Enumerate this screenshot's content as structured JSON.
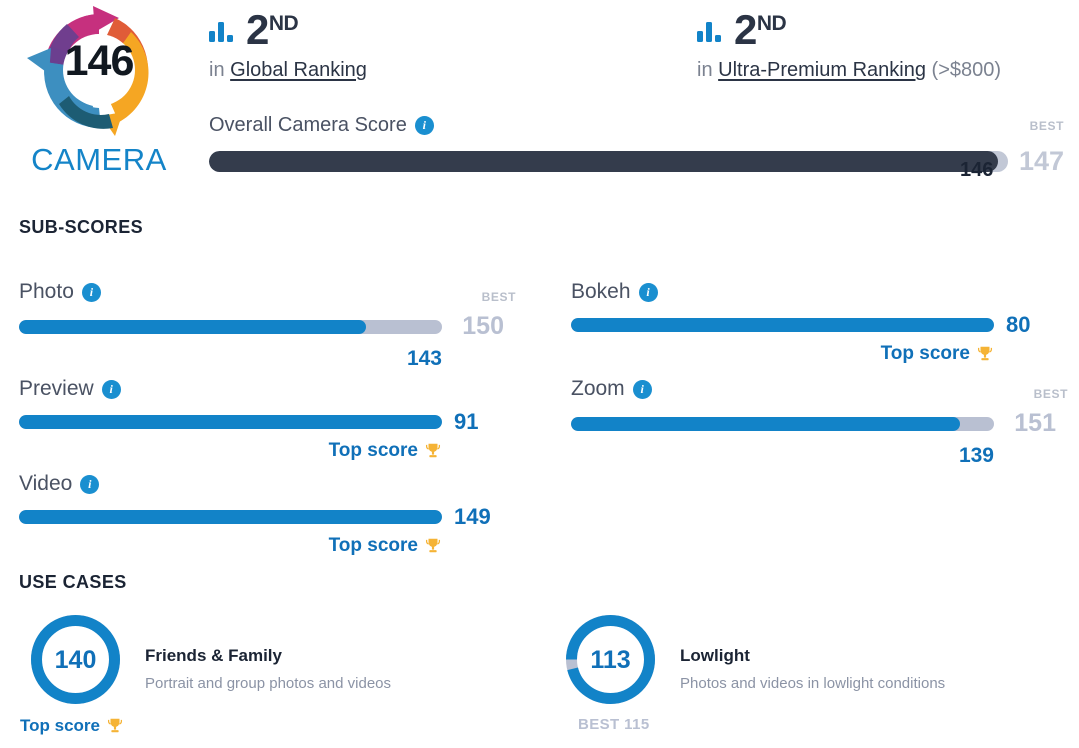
{
  "badge": {
    "score": "146",
    "label": "CAMERA",
    "logo_colors": {
      "magenta": "#c6307e",
      "purple": "#6b3f8f",
      "orange": "#e05c38",
      "amber": "#f5a623",
      "blue": "#3d8fc0",
      "teal": "#1d5c73"
    }
  },
  "rankings": [
    {
      "icon": "bar-chart-icon",
      "position": "2",
      "ordinal": "ND",
      "prefix": "in",
      "link": "Global Ranking",
      "suffix": ""
    },
    {
      "icon": "bar-chart-icon",
      "position": "2",
      "ordinal": "ND",
      "prefix": "in",
      "link": "Ultra-Premium Ranking",
      "suffix": "(>$800)"
    }
  ],
  "overall": {
    "title": "Overall Camera Score",
    "info_icon": "info-icon",
    "best_label": "BEST",
    "best_value": "147",
    "value": "146",
    "percent": 98.7,
    "bar_color": "#343c4c",
    "track_color": "#c2c8d6"
  },
  "sections": {
    "subscores_heading": "SUB-SCORES",
    "usecases_heading": "USE CASES"
  },
  "top_score_label": "Top score",
  "trophy_icon": "trophy-icon",
  "best_label": "BEST",
  "subscores": [
    {
      "name": "Photo",
      "value": "143",
      "best": "150",
      "percent": 82,
      "top_score": false,
      "show_best": true
    },
    {
      "name": "Bokeh",
      "value": "80",
      "best": "",
      "percent": 100,
      "top_score": true,
      "show_best": false
    },
    {
      "name": "Preview",
      "value": "91",
      "best": "",
      "percent": 100,
      "top_score": true,
      "show_best": false
    },
    {
      "name": "Zoom",
      "value": "139",
      "best": "151",
      "percent": 92,
      "top_score": false,
      "show_best": true
    },
    {
      "name": "Video",
      "value": "149",
      "best": "",
      "percent": 100,
      "top_score": true,
      "show_best": false
    }
  ],
  "usecases": [
    {
      "name": "Friends & Family",
      "description": "Portrait and group photos and videos",
      "value": "140",
      "percent": 100,
      "footer": "Top score",
      "footer_type": "top-score"
    },
    {
      "name": "Lowlight",
      "description": "Photos and videos in lowlight conditions",
      "value": "113",
      "percent": 96,
      "footer": "BEST 115",
      "footer_type": "best"
    }
  ],
  "chart_data": {
    "type": "bar",
    "title": "DXOMARK Camera Score Breakdown",
    "categories": [
      "Overall Camera Score",
      "Photo",
      "Bokeh",
      "Preview",
      "Zoom",
      "Video",
      "Friends & Family",
      "Lowlight"
    ],
    "values": [
      146,
      143,
      80,
      91,
      139,
      149,
      140,
      113
    ],
    "best_values": [
      147,
      150,
      80,
      91,
      151,
      149,
      140,
      115
    ],
    "xlabel": "",
    "ylabel": "Score",
    "grid": false,
    "legend": "none"
  }
}
